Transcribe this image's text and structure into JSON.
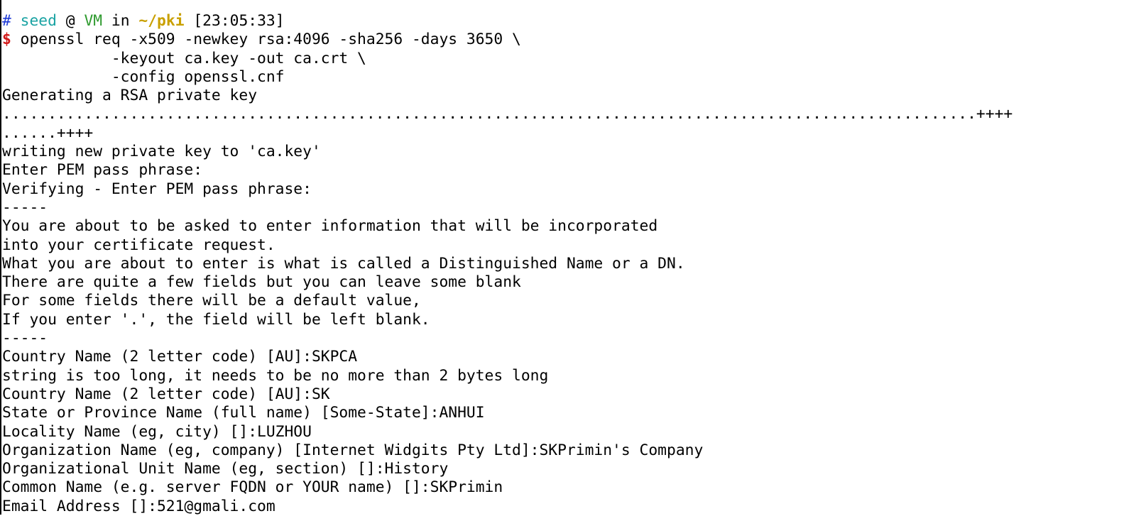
{
  "prompt": {
    "hash": "#",
    "user": "seed",
    "at": "@",
    "host": "VM",
    "in": "in",
    "dir": "~/pki",
    "time": "[23:05:33]",
    "dollar": "$"
  },
  "colors": {
    "hash": "#1f3bd6",
    "user": "#1aa3a3",
    "host": "#2e9a2e",
    "dir": "#c9a000",
    "dollar": "#d21a1a",
    "text": "#000000",
    "background": "#ffffff"
  },
  "command_lines": [
    " openssl req -x509 -newkey rsa:4096 -sha256 -days 3650 \\",
    "            -keyout ca.key -out ca.crt \\",
    "            -config openssl.cnf"
  ],
  "output_lines": [
    "Generating a RSA private key",
    "...........................................................................................................++++",
    "......++++",
    "writing new private key to 'ca.key'",
    "Enter PEM pass phrase:",
    "Verifying - Enter PEM pass phrase:",
    "-----",
    "You are about to be asked to enter information that will be incorporated",
    "into your certificate request.",
    "What you are about to enter is what is called a Distinguished Name or a DN.",
    "There are quite a few fields but you can leave some blank",
    "For some fields there will be a default value,",
    "If you enter '.', the field will be left blank.",
    "-----",
    "Country Name (2 letter code) [AU]:SKPCA",
    "string is too long, it needs to be no more than 2 bytes long",
    "Country Name (2 letter code) [AU]:SK",
    "State or Province Name (full name) [Some-State]:ANHUI",
    "Locality Name (eg, city) []:LUZHOU",
    "Organization Name (eg, company) [Internet Widgits Pty Ltd]:SKPrimin's Company",
    "Organizational Unit Name (eg, section) []:History",
    "Common Name (e.g. server FQDN or YOUR name) []:SKPrimin",
    "Email Address []:521@gmali.com"
  ]
}
